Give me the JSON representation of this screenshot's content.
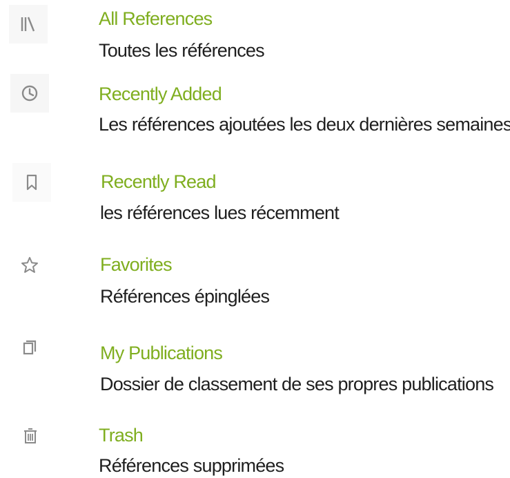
{
  "colors": {
    "title": "#7fae1f",
    "description": "#1f1f1f",
    "icon": "#8a8a8a"
  },
  "items": [
    {
      "icon": "library-icon",
      "title": "All References",
      "description": "Toutes les références"
    },
    {
      "icon": "clock-icon",
      "title": "Recently Added",
      "description": "Les références ajoutées les deux dernières semaines"
    },
    {
      "icon": "bookmark-icon",
      "title": "Recently Read",
      "description": "les références lues récemment"
    },
    {
      "icon": "star-icon",
      "title": "Favorites",
      "description": "Références épinglées"
    },
    {
      "icon": "publications-icon",
      "title": "My Publications",
      "description": "Dossier de classement de ses propres publications"
    },
    {
      "icon": "trash-icon",
      "title": "Trash",
      "description": "Références supprimées"
    }
  ]
}
